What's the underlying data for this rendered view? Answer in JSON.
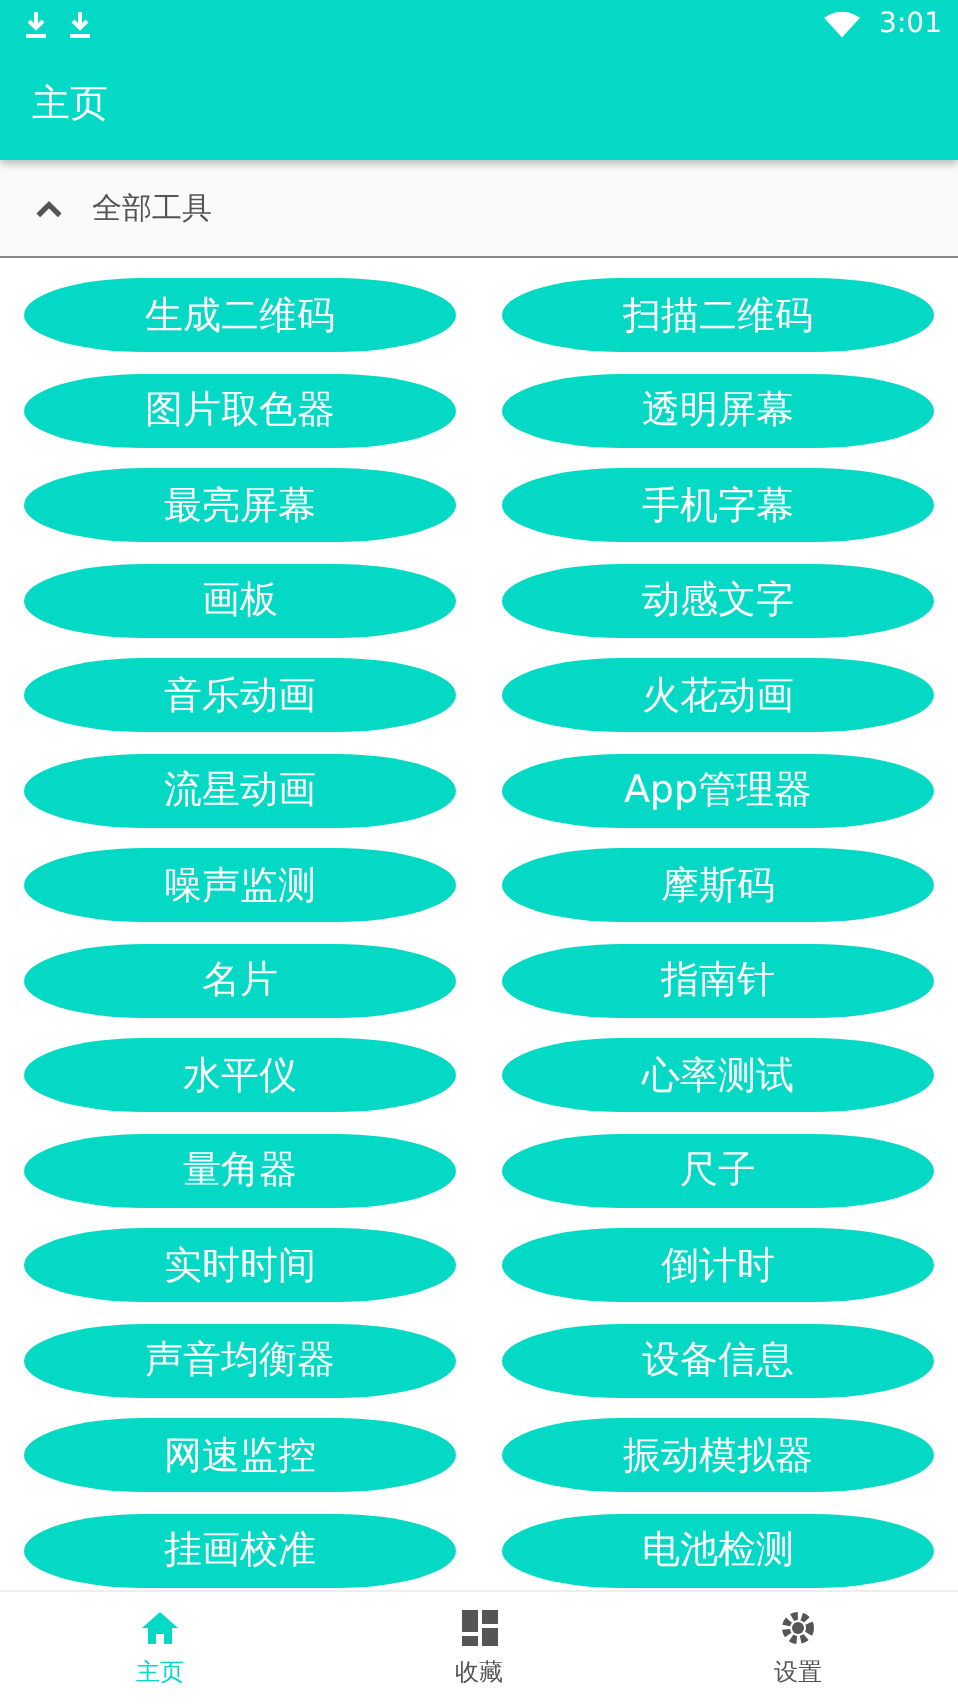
{
  "status_bar": {
    "time": "3:01"
  },
  "app_bar": {
    "title": "主页"
  },
  "section": {
    "title": "全部工具",
    "expanded": true
  },
  "tools": [
    "生成二维码",
    "扫描二维码",
    "图片取色器",
    "透明屏幕",
    "最亮屏幕",
    "手机字幕",
    "画板",
    "动感文字",
    "音乐动画",
    "火花动画",
    "流星动画",
    "App管理器",
    "噪声监测",
    "摩斯码",
    "名片",
    "指南针",
    "水平仪",
    "心率测试",
    "量角器",
    "尺子",
    "实时时间",
    "倒计时",
    "声音均衡器",
    "设备信息",
    "网速监控",
    "振动模拟器",
    "挂画校准",
    "电池检测"
  ],
  "bottom_nav": [
    {
      "label": "主页",
      "kind": "home",
      "selected": true
    },
    {
      "label": "收藏",
      "kind": "grid",
      "selected": false
    },
    {
      "label": "设置",
      "kind": "settings",
      "selected": false
    }
  ]
}
